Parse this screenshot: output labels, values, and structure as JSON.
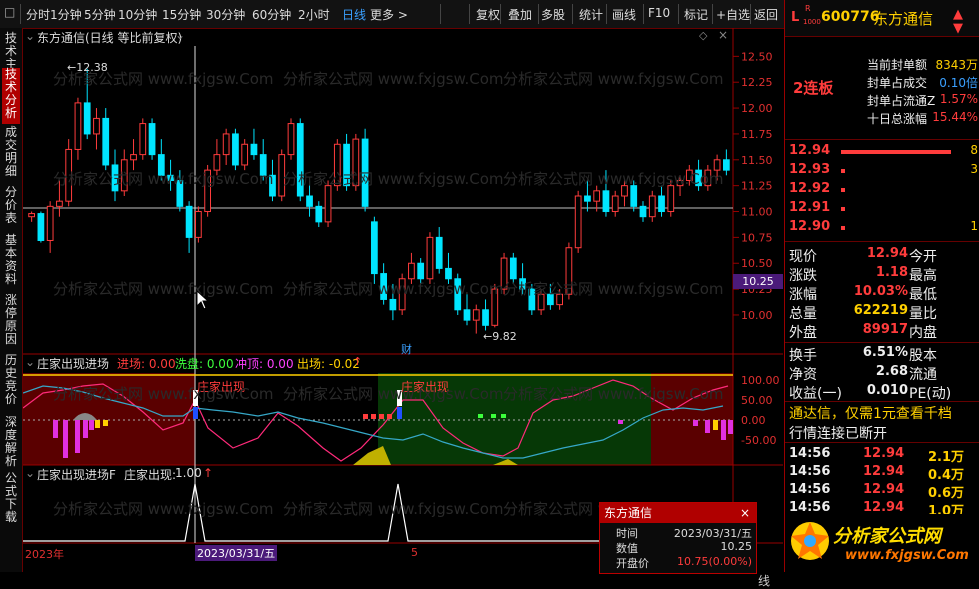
{
  "toolbar": {
    "left_icon": "□",
    "periods": [
      "分时",
      "1分钟",
      "5分钟",
      "10分钟",
      "15分钟",
      "30分钟",
      "60分钟",
      "2小时",
      "日线",
      "更多 >"
    ],
    "active_period": "日线",
    "tools": [
      "复权",
      "叠加",
      "多股",
      "统计",
      "画线",
      "F10",
      "标记",
      "+自选",
      "返回"
    ]
  },
  "left_tabs": [
    "技术主题",
    "技术分析",
    "成交明细",
    "分价表",
    "基本资料",
    "涨停原因",
    "历史竞价",
    "深度解析",
    "公式下载"
  ],
  "left_tab_active": "技术分析",
  "main_chart": {
    "title": "东方通信(日线 等比前复权)",
    "watermark": "分析家公式网 www.fxjgsw.Com",
    "high_label": "12.38",
    "low_label": "9.82",
    "cursor_price": "10.25",
    "finance_mark": "财",
    "y_ticks": [
      "12.50",
      "12.25",
      "12.00",
      "11.75",
      "11.50",
      "11.25",
      "11.00",
      "10.75",
      "10.50",
      "10.25",
      "10.00"
    ]
  },
  "chart_data": {
    "type": "candlestick",
    "ylim": [
      9.7,
      12.6
    ],
    "y_ticks": [
      12.5,
      12.25,
      12.0,
      11.75,
      11.5,
      11.25,
      11.0,
      10.75,
      10.5,
      10.25,
      10.0
    ],
    "ohlc_rise_color": "#ff3c3c",
    "ohlc_fall_color": "#00e5ff",
    "candles": [
      [
        10.95,
        11.0,
        10.9,
        10.98
      ],
      [
        10.98,
        11.0,
        10.7,
        10.72
      ],
      [
        10.72,
        11.1,
        10.6,
        11.05
      ],
      [
        11.05,
        11.3,
        10.95,
        11.1
      ],
      [
        11.1,
        11.7,
        11.05,
        11.6
      ],
      [
        11.6,
        12.1,
        11.5,
        12.05
      ],
      [
        12.05,
        12.38,
        11.7,
        11.75
      ],
      [
        11.75,
        12.0,
        11.6,
        11.9
      ],
      [
        11.9,
        12.0,
        11.4,
        11.45
      ],
      [
        11.45,
        11.6,
        11.1,
        11.2
      ],
      [
        11.2,
        11.6,
        11.15,
        11.5
      ],
      [
        11.5,
        11.7,
        11.4,
        11.55
      ],
      [
        11.55,
        11.9,
        11.5,
        11.85
      ],
      [
        11.85,
        11.9,
        11.5,
        11.55
      ],
      [
        11.55,
        11.7,
        11.3,
        11.35
      ],
      [
        11.35,
        11.5,
        11.2,
        11.3
      ],
      [
        11.3,
        11.4,
        11.0,
        11.05
      ],
      [
        11.05,
        11.1,
        10.6,
        10.75
      ],
      [
        10.75,
        11.05,
        10.7,
        11.0
      ],
      [
        11.0,
        11.45,
        10.95,
        11.4
      ],
      [
        11.4,
        11.7,
        11.35,
        11.55
      ],
      [
        11.55,
        11.8,
        11.45,
        11.75
      ],
      [
        11.75,
        11.8,
        11.4,
        11.45
      ],
      [
        11.45,
        11.7,
        11.4,
        11.65
      ],
      [
        11.65,
        11.8,
        11.5,
        11.55
      ],
      [
        11.55,
        11.7,
        11.3,
        11.35
      ],
      [
        11.35,
        11.5,
        11.1,
        11.15
      ],
      [
        11.15,
        11.6,
        11.1,
        11.55
      ],
      [
        11.55,
        11.9,
        11.5,
        11.85
      ],
      [
        11.85,
        11.9,
        11.1,
        11.15
      ],
      [
        11.15,
        11.3,
        10.95,
        11.05
      ],
      [
        11.05,
        11.1,
        10.85,
        10.9
      ],
      [
        10.9,
        11.3,
        10.85,
        11.25
      ],
      [
        11.25,
        11.7,
        11.2,
        11.65
      ],
      [
        11.65,
        11.75,
        11.2,
        11.25
      ],
      [
        11.25,
        11.75,
        11.2,
        11.7
      ],
      [
        11.7,
        11.8,
        11.0,
        11.05
      ],
      [
        10.9,
        10.95,
        10.3,
        10.4
      ],
      [
        10.4,
        10.5,
        10.1,
        10.15
      ],
      [
        10.15,
        10.3,
        9.95,
        10.05
      ],
      [
        10.05,
        10.4,
        10.0,
        10.35
      ],
      [
        10.35,
        10.6,
        10.3,
        10.5
      ],
      [
        10.5,
        10.55,
        10.3,
        10.35
      ],
      [
        10.35,
        10.8,
        10.3,
        10.75
      ],
      [
        10.75,
        10.85,
        10.4,
        10.45
      ],
      [
        10.45,
        10.6,
        10.3,
        10.35
      ],
      [
        10.35,
        10.4,
        10.0,
        10.05
      ],
      [
        10.05,
        10.2,
        9.9,
        9.95
      ],
      [
        9.95,
        10.1,
        9.82,
        10.05
      ],
      [
        10.05,
        10.15,
        9.85,
        9.9
      ],
      [
        9.9,
        10.3,
        9.88,
        10.25
      ],
      [
        10.25,
        10.6,
        10.2,
        10.55
      ],
      [
        10.55,
        10.6,
        10.3,
        10.35
      ],
      [
        10.35,
        10.5,
        10.2,
        10.25
      ],
      [
        10.25,
        10.3,
        10.0,
        10.05
      ],
      [
        10.05,
        10.25,
        10.0,
        10.2
      ],
      [
        10.2,
        10.3,
        10.05,
        10.1
      ],
      [
        10.1,
        10.25,
        10.05,
        10.2
      ],
      [
        10.2,
        10.7,
        10.15,
        10.65
      ],
      [
        10.65,
        11.2,
        10.6,
        11.15
      ],
      [
        11.15,
        11.3,
        11.0,
        11.1
      ],
      [
        11.1,
        11.25,
        11.0,
        11.2
      ],
      [
        11.2,
        11.4,
        10.95,
        11.0
      ],
      [
        11.0,
        11.2,
        10.95,
        11.15
      ],
      [
        11.15,
        11.3,
        11.05,
        11.25
      ],
      [
        11.25,
        11.3,
        11.0,
        11.05
      ],
      [
        11.05,
        11.1,
        10.9,
        10.95
      ],
      [
        10.95,
        11.2,
        10.9,
        11.15
      ],
      [
        11.15,
        11.25,
        10.95,
        11.0
      ],
      [
        11.0,
        11.3,
        10.95,
        11.25
      ],
      [
        11.25,
        11.35,
        11.15,
        11.3
      ],
      [
        11.3,
        11.45,
        11.25,
        11.4
      ],
      [
        11.4,
        11.5,
        11.2,
        11.25
      ],
      [
        11.25,
        11.45,
        11.2,
        11.4
      ],
      [
        11.4,
        11.55,
        11.3,
        11.5
      ],
      [
        11.5,
        11.6,
        11.35,
        11.4
      ]
    ]
  },
  "indicator1": {
    "name": "庄家出现进场",
    "params": [
      {
        "label": "进场:",
        "value": "0.00",
        "color": "#ff3c3c"
      },
      {
        "label": "洗盘:",
        "value": "0.00",
        "color": "#3cff3c"
      },
      {
        "label": "冲顶:",
        "value": "0.00",
        "color": "#ff40ff"
      },
      {
        "label": "出场:",
        "value": "-0.02",
        "color": "#ffd000"
      }
    ],
    "signal_text": "庄家出现",
    "y_ticks": [
      "100.00",
      "50.00",
      "0.00",
      "-50.00"
    ]
  },
  "indicator2": {
    "name": "庄家出现进场F",
    "value_label": "庄家出现:",
    "value": "1.00",
    "arrow": "↑"
  },
  "x_axis": {
    "year": "2023年",
    "cursor_date": "2023/03/31/五",
    "month_mark": "5"
  },
  "tooltip": {
    "title": "东方通信",
    "close": "×",
    "rows": [
      {
        "label": "时间",
        "value": "2023/03/31/五"
      },
      {
        "label": "数值",
        "value": "10.25"
      },
      {
        "label": "开盘价",
        "value": "10.75(0.00%)"
      }
    ]
  },
  "right_panel": {
    "code": "600776",
    "name": "东方通信",
    "badge_top": "L",
    "badge_r": "R",
    "badge_num": "1000",
    "streak": "2连板",
    "seal_info": [
      {
        "label": "当前封单额",
        "value": "8343万"
      },
      {
        "label": "封单占成交",
        "value": "0.10倍"
      },
      {
        "label": "封单占流通Z",
        "value": "1.57%"
      },
      {
        "label": "十日总涨幅",
        "value": "15.44%"
      }
    ],
    "bids": [
      {
        "price": "12.94",
        "vol": "8"
      },
      {
        "price": "12.93",
        "vol": "3"
      },
      {
        "price": "12.92",
        "vol": ""
      },
      {
        "price": "12.91",
        "vol": ""
      },
      {
        "price": "12.90",
        "vol": "1"
      }
    ],
    "quote_rows": [
      {
        "l1": "现价",
        "v1": "12.94",
        "l2": "今开"
      },
      {
        "l1": "涨跌",
        "v1": "1.18",
        "l2": "最高"
      },
      {
        "l1": "涨幅",
        "v1": "10.03%",
        "l2": "最低"
      },
      {
        "l1": "总量",
        "v1": "622219",
        "l2": "量比"
      },
      {
        "l1": "外盘",
        "v1": "89917",
        "l2": "内盘"
      }
    ],
    "quote_rows2": [
      {
        "l1": "换手",
        "v1": "6.51%",
        "l2": "股本"
      },
      {
        "l1": "净资",
        "v1": "2.68",
        "l2": "流通"
      },
      {
        "l1": "收益(一)",
        "v1": "0.010",
        "l2": "PE(动)"
      }
    ],
    "ad_text": "通达信，仅需1元查看千档",
    "conn_text": "行情连接已断开",
    "ticks": [
      {
        "time": "14:56",
        "price": "12.94",
        "vol": "2.1万"
      },
      {
        "time": "14:56",
        "price": "12.94",
        "vol": "0.4万"
      },
      {
        "time": "14:56",
        "price": "12.94",
        "vol": "0.6万"
      },
      {
        "time": "14:56",
        "price": "12.94",
        "vol": "1.0万"
      }
    ],
    "logo_text": "分析家公式网",
    "logo_url": "www.fxjgsw.Com"
  }
}
